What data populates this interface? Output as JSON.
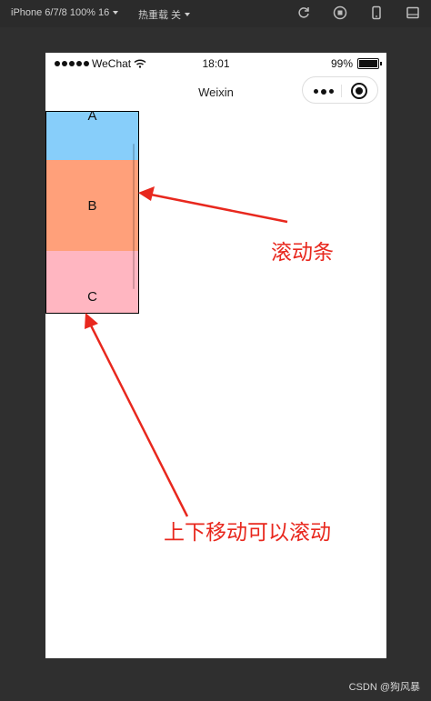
{
  "toolbar": {
    "device_label": "iPhone 6/7/8 100% 16",
    "hot_reload_label": "热重载 关",
    "icons": [
      "refresh-icon",
      "stop-icon",
      "phone-icon",
      "window-icon"
    ]
  },
  "statusbar": {
    "carrier": "WeChat",
    "time": "18:01",
    "battery": "99%",
    "battery_level": 0.99
  },
  "navbar": {
    "title": "Weixin"
  },
  "scroll_view": {
    "items": [
      {
        "label": "A",
        "color": "#87cefa"
      },
      {
        "label": "B",
        "color": "#ffa07a"
      },
      {
        "label": "C",
        "color": "#ffb6c1"
      }
    ]
  },
  "annotations": {
    "scrollbar_label": "滚动条",
    "scroll_hint": "上下移动可以滚动",
    "color": "#e8281e"
  },
  "watermark": "CSDN @狗风暴"
}
